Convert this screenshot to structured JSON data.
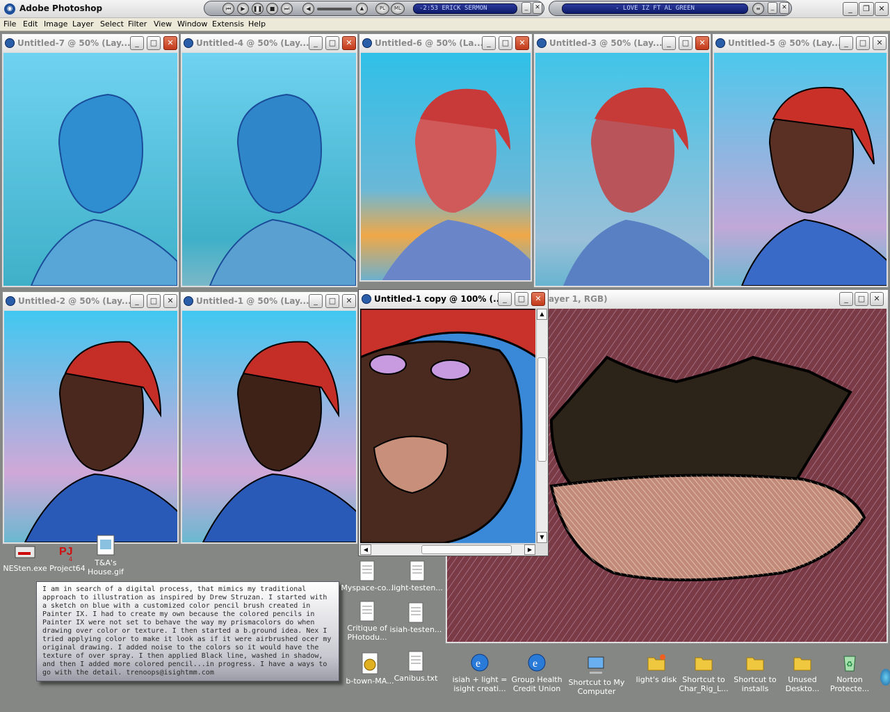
{
  "app": {
    "title": "Adobe Photoshop"
  },
  "player": {
    "track1": "-2:53  ERICK SERMON",
    "track2": "- LOVE IZ FT AL GREEN",
    "btn_pl": "PL",
    "btn_ml": "ML"
  },
  "menu": [
    "File",
    "Edit",
    "Image",
    "Layer",
    "Select",
    "Filter",
    "View",
    "Window",
    "Extensis",
    "Help"
  ],
  "docs": {
    "d7": "Untitled-7 @ 50% (Lay...",
    "d4": "Untitled-4 @ 50% (Lay...",
    "d6": "Untitled-6 @ 50% (La...",
    "d3": "Untitled-3 @ 50% (Lay...",
    "d5": "Untitled-5 @ 50% (Lay...",
    "d2": "Untitled-2 @ 50% (Lay...",
    "d1": "Untitled-1 @ 50% (Lay...",
    "dcopy": "Untitled-1 copy @ 100% (...",
    "dlips": "ayer 1, RGB)"
  },
  "desktop": {
    "nes": "NESten.exe",
    "pj64": "Project64",
    "ta": "T&A's House.gif",
    "myspace": "Myspace-co...",
    "lighttest1": "light-testen...",
    "critique": "Critique of PHotodu...",
    "isiahtest": "isiah-testen...",
    "btown": "b-town-MA...",
    "canibus": "Canibus.txt",
    "isiahlight": "isiah + light = isight creati...",
    "health": "Group Health Credit Union",
    "mycomp": "Shortcut to My Computer",
    "lightdisk": "light's disk",
    "charrig": "Shortcut to Char_Rig_L...",
    "installs": "Shortcut to installs",
    "unused": "Unused Deskto...",
    "norton": "Norton Protecte..."
  },
  "notes": "I am in search of a digital process, that mimics my traditional approach to illustration as inspired by Drew Struzan. I started with a sketch on blue with a customized color pencil brush created in Painter IX. I had to create my own because the colored pencils in Painter IX were not set to behave the way my prismacolors do when drawing over color or texture. I then started a b.ground idea. Nex I tried applying color to make it look as if it were airbrushed ocer my original drawing. I added noise to the colors so it would have the texture of over spray. I then applied Black line, washed in shadow, and then I added more colored pencil...in progress. I have a ways to go with the detail.  trenoops@isightmm.com",
  "colors": {
    "desktop": "#848784",
    "menubar": "#ece9d8",
    "sky": "#2fb8e0",
    "bandana": "#c8322a",
    "skin": "#4a2a20",
    "shirt": "#2a5cb8"
  }
}
